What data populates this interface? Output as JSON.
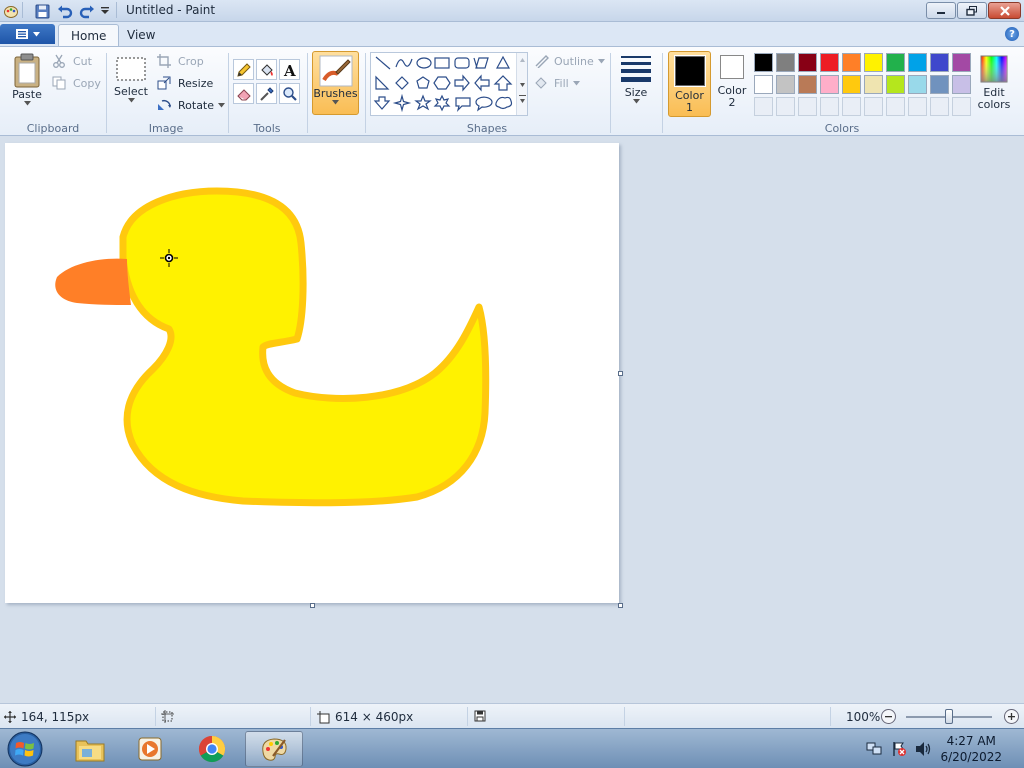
{
  "window": {
    "title": "Untitled - Paint"
  },
  "tabs": [
    {
      "label": "Home"
    },
    {
      "label": "View"
    }
  ],
  "ribbon": {
    "clipboard": {
      "paste": "Paste",
      "cut": "Cut",
      "copy": "Copy",
      "label": "Clipboard"
    },
    "image": {
      "select": "Select",
      "crop": "Crop",
      "resize": "Resize",
      "rotate": "Rotate",
      "label": "Image"
    },
    "tools": {
      "label": "Tools"
    },
    "brushes": {
      "label": "Brushes"
    },
    "shapes": {
      "outline": "Outline",
      "fill": "Fill",
      "label": "Shapes"
    },
    "size": {
      "label": "Size"
    },
    "colors": {
      "color1_line1": "Color",
      "color1_line2": "1",
      "color2_line1": "Color",
      "color2_line2": "2",
      "edit_line1": "Edit",
      "edit_line2": "colors",
      "label": "Colors",
      "color1_value": "#000000",
      "color2_value": "#ffffff",
      "palette_row1": [
        "#000000",
        "#7f7f7f",
        "#880015",
        "#ed1c24",
        "#ff7f27",
        "#fff200",
        "#22b14c",
        "#00a2e8",
        "#3f48cc",
        "#a349a4"
      ],
      "palette_row2": [
        "#ffffff",
        "#c3c3c3",
        "#b97a57",
        "#ffaec9",
        "#ffc90e",
        "#efe4b0",
        "#b5e61d",
        "#99d9ea",
        "#7092be",
        "#c8bfe7"
      ]
    }
  },
  "canvas": {
    "duck_body_color": "#fff200",
    "duck_outline_color": "#ffc90e",
    "duck_beak_color": "#ff7f27"
  },
  "status": {
    "cursor_pos": "164, 115px",
    "canvas_size": "614 × 460px",
    "zoom": "100%",
    "zoom_fraction": 0.5
  },
  "taskbar": {
    "time": "4:27 AM",
    "date": "6/20/2022"
  }
}
